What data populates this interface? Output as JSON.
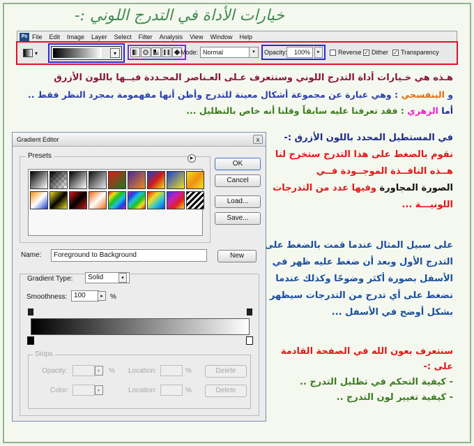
{
  "heading": "خيارات الأداة في التدرج اللوني :-",
  "photoshop": {
    "logo": "Ps",
    "menu": [
      "File",
      "Edit",
      "Image",
      "Layer",
      "Select",
      "Filter",
      "Analysis",
      "View",
      "Window",
      "Help"
    ],
    "mode_label": "Mode:",
    "mode_value": "Normal",
    "opacity_label": "Opacity:",
    "opacity_value": "100%",
    "reverse_label": "Reverse",
    "reverse_checked": false,
    "dither_label": "Dither",
    "dither_checked": true,
    "transparency_label": "Transparency",
    "transparency_checked": true
  },
  "intro": {
    "line1": "هـذه هي خـيارات أداة التدرج اللوني وسنتعرف عـلى العـناصر المحـددة فيــها باللون الأزرق",
    "line2_a": "و ",
    "line2_b": "البنفسجي",
    "line2_c": " : وهي عبارة عن مجموعة أشكال معينة للتدرج وأظن أنها مفهمومة بمجرد النظر فقط ..",
    "line3_a": "أما ",
    "line3_b": "الزهري",
    "line3_c": " : فقد تعرفنا عليه سابقاً وقلنا أنه خاص بالتظليل ..."
  },
  "right_text": {
    "p1_l1": "في المستطيل المحدد باللون الأزرق :-",
    "p1_l2": "نقوم بالضغط على هذا التدرج ستخرج لنا",
    "p1_l3": "هــذه النافــذة الموجــودة فــي",
    "p1_l4_a": "الصورة المجاورة ",
    "p1_l4_b": "وفيها عدد من التدرجات",
    "p1_l5": "اللونيـــة ...",
    "p2_l1": "على سبيل المثال عندما قمت بالضغط على",
    "p2_l2": "التدرج الأول وبعد أن ضغط عليه ظهر في",
    "p2_l3": "الأسفل بصورة أكثر وضوحًا وكذلك عندما",
    "p2_l4": "نضغط على أي تدرج من التدرجات سيظهر",
    "p2_l5": "بشكل أوضح في الأسفل ...",
    "p3_l1": "سنتعرف بعون الله في الصفحة القادمة",
    "p3_l2": "على :-",
    "p3_l3": "- كيفية التحكم في تظليل التدرج ..",
    "p3_l4": "- كيفية تغيير لون التدرج .."
  },
  "dialog": {
    "title": "Gradient Editor",
    "close": "x",
    "presets_label": "Presets",
    "menu_arrow": "▶",
    "ok": "OK",
    "cancel": "Cancel",
    "load": "Load...",
    "save": "Save...",
    "name_label": "Name:",
    "name_value": "Foreground to Background",
    "new": "New",
    "gradient_type_label": "Gradient Type:",
    "gradient_type_value": "Solid",
    "smoothness_label": "Smoothness:",
    "smoothness_value": "100",
    "percent": "%",
    "stops_label": "Stops",
    "opacity_label": "Opacity:",
    "color_label": "Color:",
    "location_label": "Location:",
    "delete": "Delete"
  }
}
